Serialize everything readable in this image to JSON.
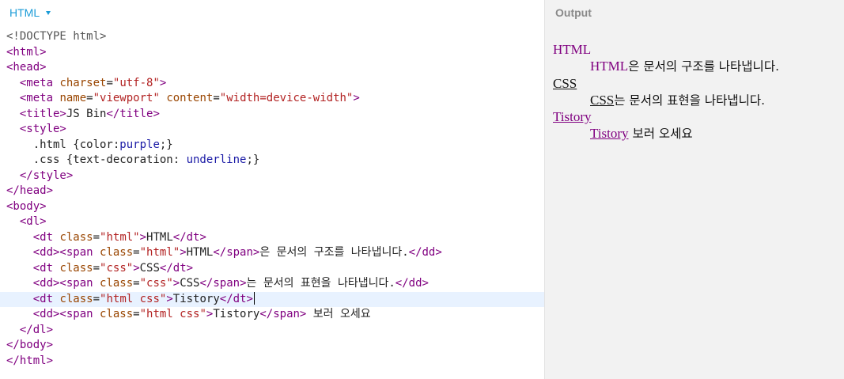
{
  "editor": {
    "panel_label": "HTML",
    "lines": [
      [
        {
          "t": "doctype",
          "v": "<!DOCTYPE html>"
        }
      ],
      [
        {
          "t": "tag",
          "v": "<html>"
        }
      ],
      [
        {
          "t": "tag",
          "v": "<head>"
        }
      ],
      [
        {
          "t": "text",
          "v": "  "
        },
        {
          "t": "tag",
          "v": "<meta "
        },
        {
          "t": "attr",
          "v": "charset"
        },
        {
          "t": "text",
          "v": "="
        },
        {
          "t": "str",
          "v": "\"utf-8\""
        },
        {
          "t": "tag",
          "v": ">"
        }
      ],
      [
        {
          "t": "text",
          "v": "  "
        },
        {
          "t": "tag",
          "v": "<meta "
        },
        {
          "t": "attr",
          "v": "name"
        },
        {
          "t": "text",
          "v": "="
        },
        {
          "t": "str",
          "v": "\"viewport\""
        },
        {
          "t": "text",
          "v": " "
        },
        {
          "t": "attr",
          "v": "content"
        },
        {
          "t": "text",
          "v": "="
        },
        {
          "t": "str",
          "v": "\"width=device-width\""
        },
        {
          "t": "tag",
          "v": ">"
        }
      ],
      [
        {
          "t": "text",
          "v": "  "
        },
        {
          "t": "tag",
          "v": "<title>"
        },
        {
          "t": "text",
          "v": "JS Bin"
        },
        {
          "t": "tag",
          "v": "</title>"
        }
      ],
      [
        {
          "t": "text",
          "v": "  "
        },
        {
          "t": "tag",
          "v": "<style>"
        }
      ],
      [
        {
          "t": "text",
          "v": "    .html {color:"
        },
        {
          "t": "kw",
          "v": "purple"
        },
        {
          "t": "text",
          "v": ";}"
        }
      ],
      [
        {
          "t": "text",
          "v": "    .css {text-decoration: "
        },
        {
          "t": "kw",
          "v": "underline"
        },
        {
          "t": "text",
          "v": ";}"
        }
      ],
      [
        {
          "t": "text",
          "v": "  "
        },
        {
          "t": "tag",
          "v": "</style>"
        }
      ],
      [
        {
          "t": "tag",
          "v": "</head>"
        }
      ],
      [
        {
          "t": "tag",
          "v": "<body>"
        }
      ],
      [
        {
          "t": "text",
          "v": "  "
        },
        {
          "t": "tag",
          "v": "<dl>"
        }
      ],
      [
        {
          "t": "text",
          "v": "    "
        },
        {
          "t": "tag",
          "v": "<dt "
        },
        {
          "t": "attr",
          "v": "class"
        },
        {
          "t": "text",
          "v": "="
        },
        {
          "t": "str",
          "v": "\"html\""
        },
        {
          "t": "tag",
          "v": ">"
        },
        {
          "t": "text",
          "v": "HTML"
        },
        {
          "t": "tag",
          "v": "</dt>"
        }
      ],
      [
        {
          "t": "text",
          "v": "    "
        },
        {
          "t": "tag",
          "v": "<dd><span "
        },
        {
          "t": "attr",
          "v": "class"
        },
        {
          "t": "text",
          "v": "="
        },
        {
          "t": "str",
          "v": "\"html\""
        },
        {
          "t": "tag",
          "v": ">"
        },
        {
          "t": "text",
          "v": "HTML"
        },
        {
          "t": "tag",
          "v": "</span>"
        },
        {
          "t": "text",
          "v": "은 문서의 구조를 나타냅니다."
        },
        {
          "t": "tag",
          "v": "</dd>"
        }
      ],
      [
        {
          "t": "text",
          "v": "    "
        },
        {
          "t": "tag",
          "v": "<dt "
        },
        {
          "t": "attr",
          "v": "class"
        },
        {
          "t": "text",
          "v": "="
        },
        {
          "t": "str",
          "v": "\"css\""
        },
        {
          "t": "tag",
          "v": ">"
        },
        {
          "t": "text",
          "v": "CSS"
        },
        {
          "t": "tag",
          "v": "</dt>"
        }
      ],
      [
        {
          "t": "text",
          "v": "    "
        },
        {
          "t": "tag",
          "v": "<dd><span "
        },
        {
          "t": "attr",
          "v": "class"
        },
        {
          "t": "text",
          "v": "="
        },
        {
          "t": "str",
          "v": "\"css\""
        },
        {
          "t": "tag",
          "v": ">"
        },
        {
          "t": "text",
          "v": "CSS"
        },
        {
          "t": "tag",
          "v": "</span>"
        },
        {
          "t": "text",
          "v": "는 문서의 표현을 나타냅니다."
        },
        {
          "t": "tag",
          "v": "</dd>"
        }
      ],
      [
        {
          "t": "text",
          "v": "    "
        },
        {
          "t": "tag",
          "v": "<dt "
        },
        {
          "t": "attr",
          "v": "class"
        },
        {
          "t": "text",
          "v": "="
        },
        {
          "t": "str",
          "v": "\"html css\""
        },
        {
          "t": "tag",
          "v": ">"
        },
        {
          "t": "text",
          "v": "Tistory"
        },
        {
          "t": "tag",
          "v": "</dt>"
        }
      ],
      [
        {
          "t": "text",
          "v": "    "
        },
        {
          "t": "tag",
          "v": "<dd><span "
        },
        {
          "t": "attr",
          "v": "class"
        },
        {
          "t": "text",
          "v": "="
        },
        {
          "t": "str",
          "v": "\"html css\""
        },
        {
          "t": "tag",
          "v": ">"
        },
        {
          "t": "text",
          "v": "Tistory"
        },
        {
          "t": "tag",
          "v": "</span>"
        },
        {
          "t": "text",
          "v": " 보러 오세요"
        }
      ],
      [
        {
          "t": "text",
          "v": "  "
        },
        {
          "t": "tag",
          "v": "</dl>"
        }
      ],
      [
        {
          "t": "tag",
          "v": "</body>"
        }
      ],
      [
        {
          "t": "tag",
          "v": "</html>"
        }
      ]
    ],
    "active_line": 17
  },
  "output": {
    "label": "Output",
    "entries": [
      {
        "term": "HTML",
        "term_classes": [
          "html"
        ],
        "desc_span": "HTML",
        "desc_span_classes": [
          "html"
        ],
        "desc_rest": "은 문서의 구조를 나타냅니다."
      },
      {
        "term": "CSS",
        "term_classes": [
          "css"
        ],
        "desc_span": "CSS",
        "desc_span_classes": [
          "css"
        ],
        "desc_rest": "는 문서의 표현을 나타냅니다."
      },
      {
        "term": "Tistory",
        "term_classes": [
          "html",
          "css"
        ],
        "desc_span": "Tistory",
        "desc_span_classes": [
          "html",
          "css"
        ],
        "desc_rest": " 보러 오세요"
      }
    ]
  }
}
